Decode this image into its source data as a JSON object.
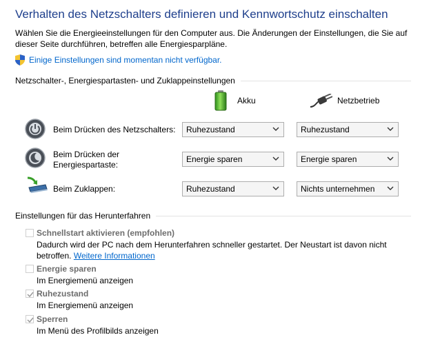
{
  "page_title": "Verhalten des Netzschalters definieren und Kennwortschutz einschalten",
  "intro_text": "Wählen Sie die Energieeinstellungen für den Computer aus. Die Änderungen der Einstellungen, die Sie auf dieser Seite durchführen, betreffen alle Energiesparpläne.",
  "unavailable_link": "Einige Einstellungen sind momentan nicht verfügbar.",
  "buttons_section": {
    "title": "Netzschalter-, Energiespartasten- und Zuklappeinstellungen",
    "col_battery": "Akku",
    "col_plugged": "Netzbetrieb",
    "rows": [
      {
        "label": "Beim Drücken des Netzschalters:",
        "battery": "Ruhezustand",
        "plugged": "Ruhezustand"
      },
      {
        "label": "Beim Drücken der Energiespartaste:",
        "battery": "Energie sparen",
        "plugged": "Energie sparen"
      },
      {
        "label": "Beim Zuklappen:",
        "battery": "Ruhezustand",
        "plugged": "Nichts unternehmen"
      }
    ]
  },
  "shutdown_section": {
    "title": "Einstellungen für das Herunterfahren",
    "options": [
      {
        "label": "Schnellstart aktivieren (empfohlen)",
        "checked": false,
        "desc": "Dadurch wird der PC nach dem Herunterfahren schneller gestartet. Der Neustart ist davon nicht betroffen.",
        "link": "Weitere Informationen"
      },
      {
        "label": "Energie sparen",
        "checked": false,
        "desc": "Im Energiemenü anzeigen"
      },
      {
        "label": "Ruhezustand",
        "checked": true,
        "desc": "Im Energiemenü anzeigen"
      },
      {
        "label": "Sperren",
        "checked": true,
        "desc": "Im Menü des Profilbilds anzeigen"
      }
    ]
  },
  "colors": {
    "title": "#1e3f8c",
    "link": "#0066cc",
    "disabled_text": "#6d6d6d"
  },
  "icons": [
    "shield-icon",
    "battery-icon",
    "power-plug-icon",
    "power-button-icon",
    "sleep-button-icon",
    "lid-close-icon",
    "chevron-down-icon",
    "checkmark-icon"
  ]
}
